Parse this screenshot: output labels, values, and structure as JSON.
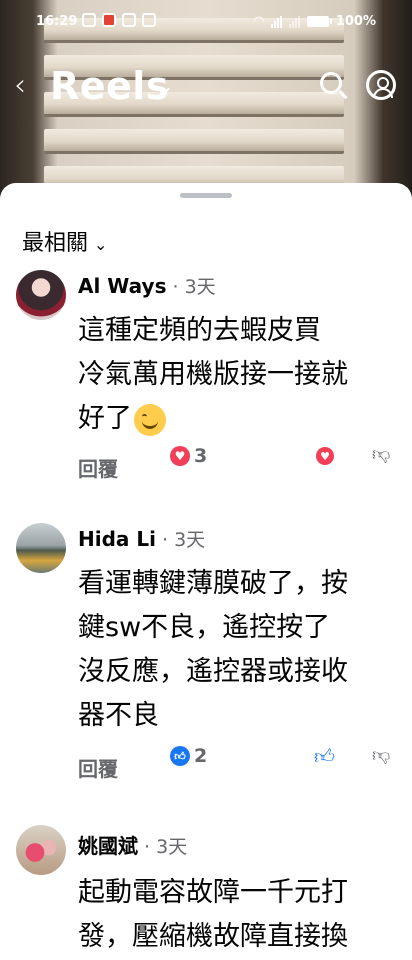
{
  "status_bar": {
    "time": "16:29",
    "battery": "100%"
  },
  "header": {
    "back_icon": "chevron-left-icon",
    "title": "Reels",
    "title_chevron": "⌄"
  },
  "sheet": {
    "sort_label": "最相關",
    "sort_chevron": "⌄"
  },
  "comments": [
    {
      "name": "Al Ways",
      "time": " · 3天",
      "text_lines": [
        "這種定頻的去蝦皮買",
        "冷氣萬用機版接一接就",
        "好了"
      ],
      "reply": "回覆",
      "reaction_type": "heart",
      "reaction_count": "3"
    },
    {
      "name": "Hida Li",
      "time": " · 3天",
      "text_lines": [
        "看運轉鍵薄膜破了，按",
        "鍵sw不良，遙控按了",
        "沒反應，遙控器或接收",
        "器不良"
      ],
      "reply": "回覆",
      "reaction_type": "like",
      "reaction_count": "2"
    },
    {
      "name": "姚國斌",
      "time": " · 3天",
      "text_lines": [
        "起動電容故障一千元打",
        "發，壓縮機故障直接換"
      ]
    }
  ],
  "colors": {
    "heart": "#f33e58",
    "like": "#1877f2",
    "muted": "#65676b"
  }
}
